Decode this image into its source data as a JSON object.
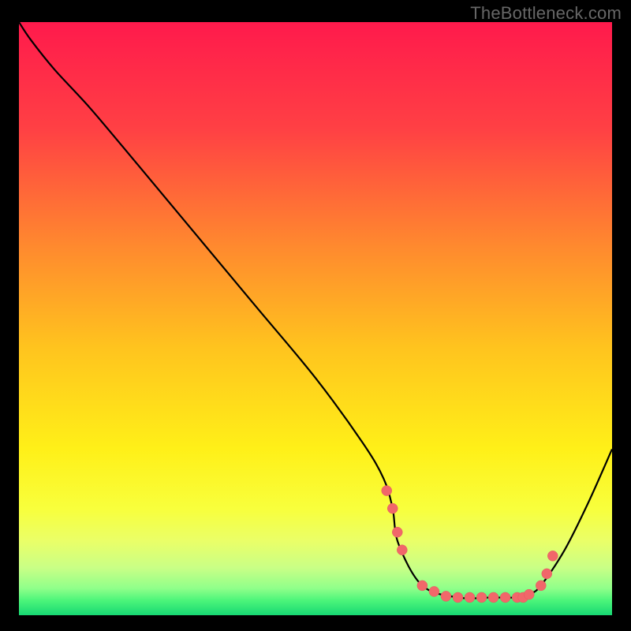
{
  "watermark": "TheBottleneck.com",
  "colors": {
    "frame": "#000000",
    "curve": "#000000",
    "marker_fill": "#f1676a",
    "marker_stroke": "#e25a5d"
  },
  "chart_data": {
    "type": "line",
    "title": "",
    "xlabel": "",
    "ylabel": "",
    "xlim": [
      0,
      100
    ],
    "ylim": [
      0,
      100
    ],
    "grid": false,
    "background": "vertical-gradient red→yellow→green",
    "gradient_stops": [
      {
        "pos": 0.0,
        "color": "#ff1a4c"
      },
      {
        "pos": 0.18,
        "color": "#ff4044"
      },
      {
        "pos": 0.38,
        "color": "#ff8a2e"
      },
      {
        "pos": 0.55,
        "color": "#ffc41e"
      },
      {
        "pos": 0.72,
        "color": "#fff018"
      },
      {
        "pos": 0.82,
        "color": "#f8ff3c"
      },
      {
        "pos": 0.875,
        "color": "#eaff68"
      },
      {
        "pos": 0.92,
        "color": "#c9ff86"
      },
      {
        "pos": 0.955,
        "color": "#8fff8a"
      },
      {
        "pos": 0.975,
        "color": "#4cf57a"
      },
      {
        "pos": 1.0,
        "color": "#17d873"
      }
    ],
    "series": [
      {
        "name": "curve",
        "x": [
          0,
          2,
          6,
          12,
          20,
          30,
          40,
          50,
          58,
          61.5,
          63,
          64,
          68,
          74,
          80,
          84,
          86,
          88,
          92,
          96,
          100
        ],
        "y": [
          100,
          97,
          92,
          85.5,
          76,
          64,
          52,
          40,
          29,
          23,
          18,
          12,
          5,
          3,
          3,
          3,
          3.5,
          5,
          11,
          19,
          28
        ]
      }
    ],
    "markers": {
      "name": "highlighted-points",
      "color": "#f1676a",
      "x": [
        62,
        63,
        63.8,
        64.6,
        68,
        70,
        72,
        74,
        76,
        78,
        80,
        82,
        84,
        85,
        86,
        88,
        89,
        90
      ],
      "y": [
        21,
        18,
        14,
        11,
        5,
        4,
        3.2,
        3,
        3,
        3,
        3,
        3,
        3,
        3,
        3.5,
        5,
        7,
        10
      ]
    }
  }
}
